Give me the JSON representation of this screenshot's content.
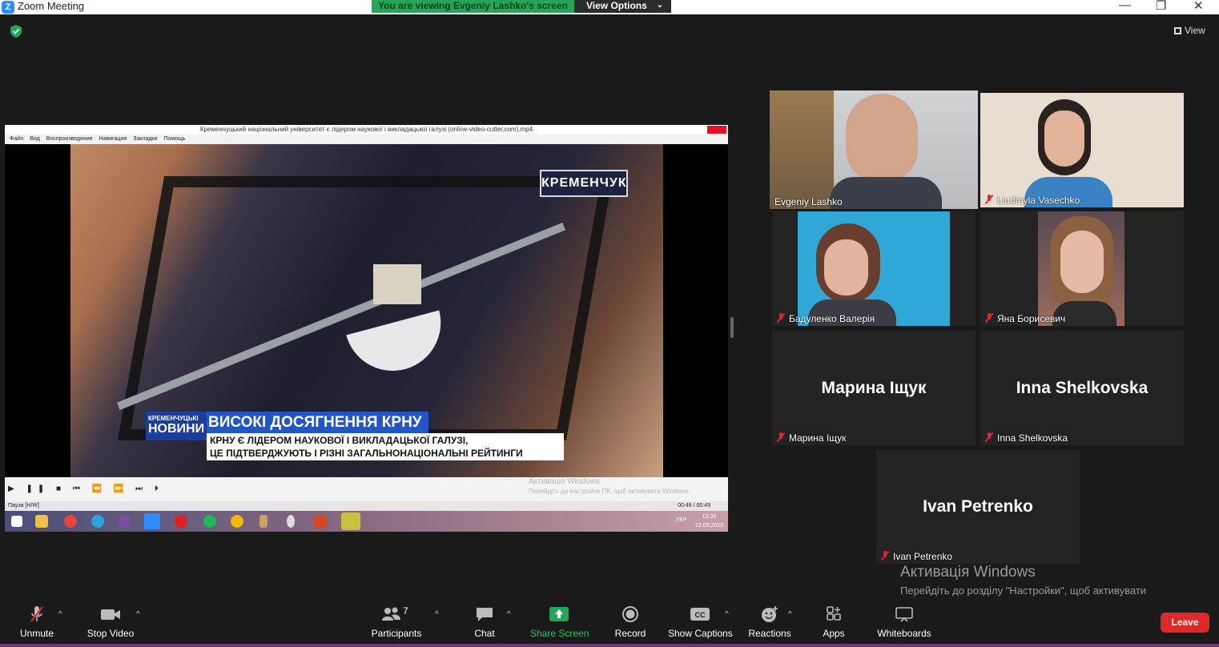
{
  "window": {
    "title": "Zoom Meeting",
    "minimize": "—",
    "restore": "❐",
    "close": "✕"
  },
  "banner": {
    "viewing_text": "You are viewing Evgeniy Lashko's screen",
    "view_options": "View Options"
  },
  "top": {
    "view_label": "View"
  },
  "shared_screen": {
    "player_title": "Кременчуцький національний університет є лідером наукової і викладацької галузі (online-video-cutter.com).mp4",
    "menu": [
      "Файл",
      "Вид",
      "Воспроизведение",
      "Навигация",
      "Закладки",
      "Помощь"
    ],
    "channel_logo": "КРЕМЕНЧУК",
    "news_tag_small": "КРЕМЕНЧУЦЬКІ",
    "news_tag_big": "НОВИНИ",
    "headline": "ВИСОКІ ДОСЯГНЕННЯ КРНУ",
    "subtitle_1": "КРНУ Є ЛІДЕРОМ НАУКОВОЇ І ВИКЛАДАЦЬКОЇ ГАЛУЗІ,",
    "subtitle_2": "ЦЕ ПІДТВЕРДЖУЮТЬ І РІЗНІ ЗАГАЛЬНОНАЦІОНАЛЬНІ РЕЙТИНГИ",
    "controls": "▶ ❚❚ ■ ⏮ ⏪ ⏩ ⏭ ⏵",
    "activate_small_1": "Активація Windows",
    "activate_small_2": "Перейдіть до настройок ПК, щоб активувати Windows.",
    "status_left": "Пауза [H/W]",
    "status_time": "00:49 / 00:49",
    "taskbar_lang": "УКР",
    "taskbar_time": "13:39",
    "taskbar_date": "22.09.2023"
  },
  "participants": [
    {
      "name": "Evgeniy Lashko",
      "muted": false,
      "video": true,
      "active": true
    },
    {
      "name": "Liudmyla Vasechko",
      "muted": true,
      "video": true
    },
    {
      "name": "Бадуленко Валерія",
      "muted": true,
      "video": true
    },
    {
      "name": "Яна Борисевич",
      "muted": true,
      "video": true
    },
    {
      "name": "Марина Іщук",
      "muted": true,
      "video": false,
      "display": "Марина Іщук"
    },
    {
      "name": "Inna Shelkovska",
      "muted": true,
      "video": false,
      "display": "Inna Shelkovska"
    },
    {
      "name": "Ivan Petrenko",
      "muted": true,
      "video": false,
      "display": "Ivan Petrenko"
    }
  ],
  "watermark": {
    "title": "Активація Windows",
    "text": "Перейдіть до розділу \"Настройки\", щоб активувати Windows."
  },
  "toolbar": {
    "unmute": "Unmute",
    "stop_video": "Stop Video",
    "participants": "Participants",
    "participants_count": "7",
    "chat": "Chat",
    "share_screen": "Share Screen",
    "record": "Record",
    "show_captions": "Show Captions",
    "reactions": "Reactions",
    "apps": "Apps",
    "whiteboards": "Whiteboards",
    "leave": "Leave"
  },
  "colors": {
    "accent_green": "#23a55a",
    "leave_red": "#e02828",
    "active_speaker": "#e8e84c"
  }
}
